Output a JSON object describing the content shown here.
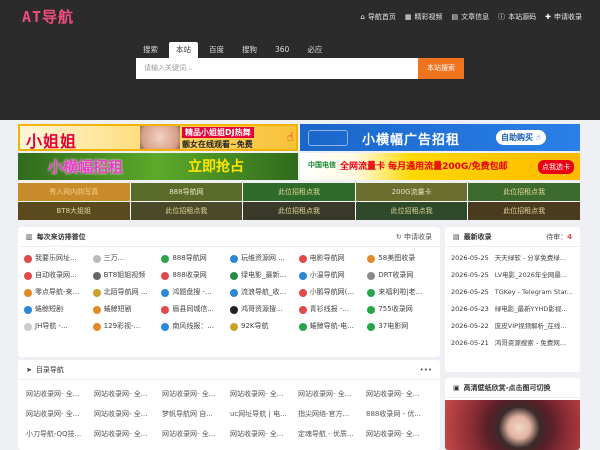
{
  "header": {
    "logo": "AT导航",
    "nav": [
      {
        "icon": "home-icon",
        "glyph": "⌂",
        "label": "导航首页"
      },
      {
        "icon": "grid-icon",
        "glyph": "▦",
        "label": "精彩视频"
      },
      {
        "icon": "book-icon",
        "glyph": "▤",
        "label": "文章信息"
      },
      {
        "icon": "info-icon",
        "glyph": "ⓘ",
        "label": "本站源码"
      },
      {
        "icon": "user-plus-icon",
        "glyph": "✚",
        "label": "申请收录"
      }
    ]
  },
  "search": {
    "tabs": [
      "搜索",
      "本站",
      "百度",
      "搜狗",
      "360",
      "必应"
    ],
    "active_tab": 1,
    "placeholder": "请输入关键词...",
    "button": "本站搜索"
  },
  "banners": {
    "b1": {
      "big": "小姐姐",
      "r1": "精品小姐姐DJ热舞",
      "r2": "靓女在线观看~免费",
      "hand": "☝"
    },
    "b2": {
      "big": "小横幅广告招租",
      "pill": "自助购买 ☝"
    },
    "b3": {
      "big": "小横幅招租",
      "big2": "立即抢占"
    },
    "b4": {
      "logo": "中国电信",
      "big": "全网流量卡 每月通用流量200G/免费包邮",
      "btn": "点我选卡"
    }
  },
  "grid_links": [
    {
      "label": "秀人网内购写真",
      "bg": "#c98a2a",
      "color": "#f1d28a"
    },
    {
      "label": "888导航网",
      "bg": "#5a6b2a",
      "color": "#e8e6c8"
    },
    {
      "label": "此位招租点我",
      "bg": "#2e6b2a",
      "color": "#e4d79a"
    },
    {
      "label": "200G流量卡",
      "bg": "#6a6f2e",
      "color": "#e8e6c8"
    },
    {
      "label": "此位招租点我",
      "bg": "#3d6b2e",
      "color": "#e4d79a"
    },
    {
      "label": "BT8大姐姐",
      "bg": "#5a4a1e",
      "color": "#e4d79a"
    },
    {
      "label": "此位招租点我",
      "bg": "#4a4a2a",
      "color": "#e4d79a"
    },
    {
      "label": "此位招租点我",
      "bg": "#3a3a2a",
      "color": "#e4d79a"
    },
    {
      "label": "此位招租点我",
      "bg": "#2e4a2a",
      "color": "#e4d79a"
    },
    {
      "label": "此位招租点我",
      "bg": "#4a3a1e",
      "color": "#e4d79a"
    }
  ],
  "visitors": {
    "title": "每次来访排普位",
    "action": "申请收录",
    "items": [
      {
        "label": "我要乐网址...",
        "c": "#e24a4a"
      },
      {
        "label": "三万...",
        "c": "#bbbbbb"
      },
      {
        "label": "888导航网",
        "c": "#2aa44a"
      },
      {
        "label": "玩维资源网 ...",
        "c": "#2a88d8"
      },
      {
        "label": "电影导航网",
        "c": "#e24a4a"
      },
      {
        "label": "58美图收录",
        "c": "#e28a2a"
      },
      {
        "label": "自动收录网...",
        "c": "#e24a4a"
      },
      {
        "label": "BT8姐姐视频",
        "c": "#666666"
      },
      {
        "label": "888收录网",
        "c": "#e24a4a"
      },
      {
        "label": "绿电影_最新...",
        "c": "#2a8a4a"
      },
      {
        "label": "小温导航网",
        "c": "#2a88d8"
      },
      {
        "label": "DRT收录网",
        "c": "#8a8a8a"
      },
      {
        "label": "零点导航-来...",
        "c": "#e28a2a"
      },
      {
        "label": "北陌导航网 ...",
        "c": "#caa02a"
      },
      {
        "label": "鸿题盘搜 -...",
        "c": "#2a88d8"
      },
      {
        "label": "流浪导航_收...",
        "c": "#2a88d8"
      },
      {
        "label": "小鹅导航网(...",
        "c": "#e24a4a"
      },
      {
        "label": "来福利啦|老...",
        "c": "#2aa44a"
      },
      {
        "label": "蜷鲸短剧",
        "c": "#2a88d8"
      },
      {
        "label": "蜷鲸短剧",
        "c": "#e28a2a"
      },
      {
        "label": "眉县同城信...",
        "c": "#e24a4a"
      },
      {
        "label": "鸿哥资源搜...",
        "c": "#222222"
      },
      {
        "label": "青衫线报 -...",
        "c": "#e24a4a"
      },
      {
        "label": "755收录网",
        "c": "#2aa44a"
      },
      {
        "label": "JH导航 -...",
        "c": "#cccccc"
      },
      {
        "label": "129彩视-...",
        "c": "#e28a2a"
      },
      {
        "label": "南风线报：...",
        "c": "#2a88d8"
      },
      {
        "label": "92K导航",
        "c": "#caa02a"
      },
      {
        "label": "蜷鲸导航-电...",
        "c": "#2aa44a"
      },
      {
        "label": "37电影网",
        "c": "#2aa44a"
      }
    ]
  },
  "directory": {
    "title": "目录导航",
    "more": "•••",
    "items": [
      "网站收录网- 全...",
      "网站收录网- 全...",
      "网站收录网- 全...",
      "网站收录网- 全...",
      "网站收录网- 全...",
      "网站收录网- 全...",
      "网站收录网- 全...",
      "网站收录网- 全...",
      "梦帆导航网 自...",
      "uc网址导航 | 电...",
      "指尖网络-官方...",
      "888收录网 - 优...",
      "小刀导航-QQ技...",
      "网站收录网- 全...",
      "网站收录网- 全...",
      "网站收录网- 全...",
      "定魂导航 - 优质...",
      "网站收录网- 全..."
    ]
  },
  "recent": {
    "title": "最新收录",
    "pending_label": "待审：",
    "pending_count": "4",
    "items": [
      {
        "date": "2026-05-25",
        "text": "天天绿软 - 分享免费绿..."
      },
      {
        "date": "2026-05-25",
        "text": "LV电影_2026年全网最..."
      },
      {
        "date": "2026-05-25",
        "text": "TGKey - Telegram Star..."
      },
      {
        "date": "2026-05-23",
        "text": "绿电影_最新YYHD影视..."
      },
      {
        "date": "2026-05-22",
        "text": "庞皮VIP视频解析_在线..."
      },
      {
        "date": "2026-05-21",
        "text": "鸿哥资源搜索 - 免费网..."
      }
    ]
  },
  "wallpaper": {
    "title": "高清壁纸欣赏-点击图可切换"
  }
}
